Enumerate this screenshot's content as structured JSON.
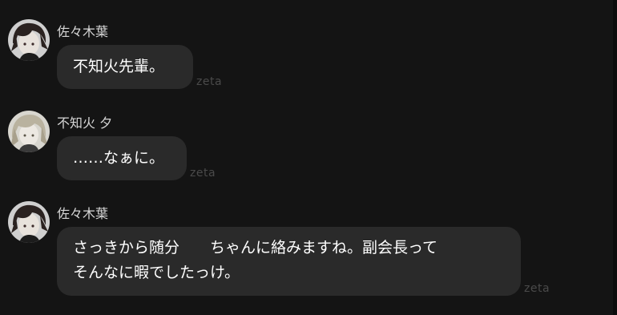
{
  "messages": [
    {
      "sender": "佐々木葉",
      "text": "不知火先輩。",
      "model_tag": "zeta",
      "avatar_icon": "dark-hair-character-avatar-icon"
    },
    {
      "sender": "不知火 夕",
      "text": "……なぁに。",
      "model_tag": "zeta",
      "avatar_icon": "light-hair-character-avatar-icon"
    },
    {
      "sender": "佐々木葉",
      "lines": [
        "さっきから随分　　ちゃんに絡みますね。副会長って",
        "そんなに暇でしたっけ。"
      ],
      "model_tag": "zeta",
      "avatar_icon": "dark-hair-character-avatar-icon"
    }
  ],
  "colors": {
    "background": "#141414",
    "bubble": "#2a2a2a",
    "sender_text": "#d6d6d6",
    "message_text": "#ffffff",
    "model_tag": "#4a4a4a"
  }
}
